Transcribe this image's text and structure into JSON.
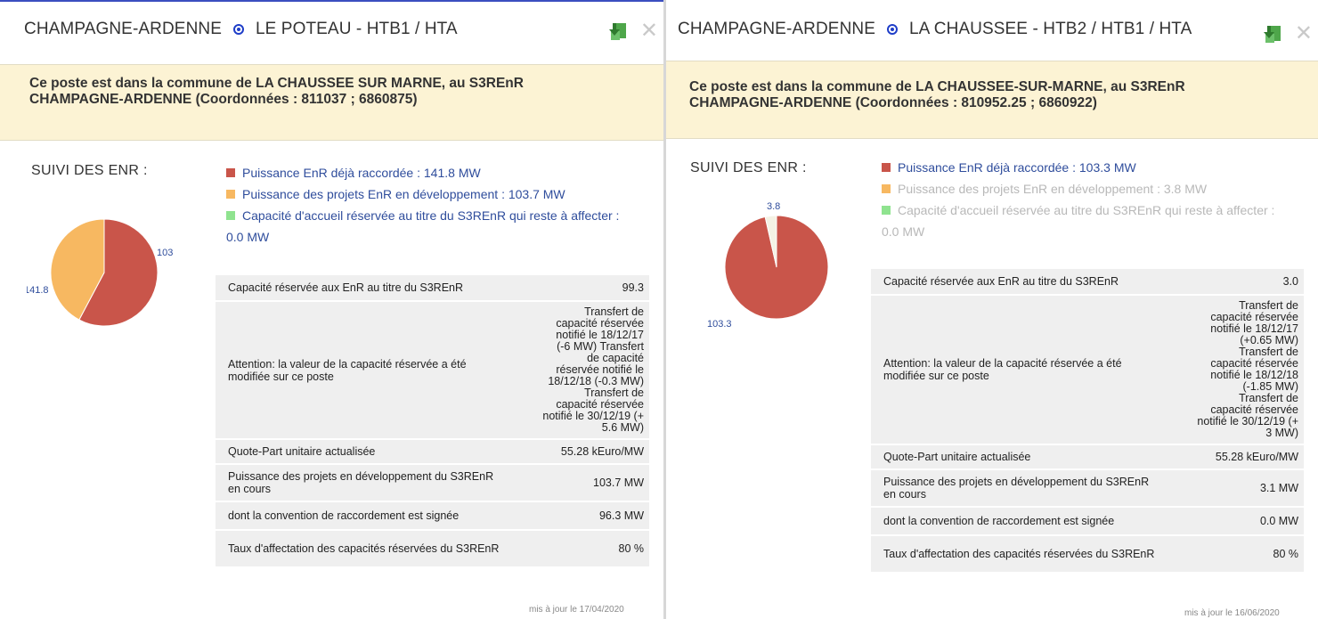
{
  "left": {
    "region": "CHAMPAGNE-ARDENNE",
    "post": "LE POTEAU - HTB1 / HTA",
    "banner_line1": "Ce poste est dans la commune de LA CHAUSSEE SUR MARNE, au S3REnR",
    "banner_line2": "CHAMPAGNE-ARDENNE (Coordonnées : 811037 ; 6860875)",
    "suivi": "SUIVI DES ENR :",
    "legend": [
      {
        "text": "Puissance EnR déjà raccordée : 141.8 MW",
        "color": "#c9554a"
      },
      {
        "text": "Puissance des projets EnR en développement : 103.7 MW",
        "color": "#f7b861"
      },
      {
        "text": "Capacité d'accueil réservée au titre du S3REnR qui reste à affecter : 0.0 MW",
        "color": "#8fe38f"
      }
    ],
    "pie": {
      "values": [
        141.8,
        103.7,
        0.0
      ],
      "labels": [
        "141.8",
        "103",
        ""
      ],
      "colors": [
        "#c9554a",
        "#f7b861",
        "#8fe38f"
      ]
    },
    "rows": [
      {
        "label": "Capacité réservée aux EnR au titre du S3REnR",
        "value": "99.3"
      },
      {
        "label": "Attention: la valeur de la capacité réservée a été modifiée sur ce poste",
        "value": "Transfert de capacité réservée notifié le 18/12/17 (-6 MW) Transfert de capacité réservée notifié le 18/12/18 (-0.3 MW) Transfert de capacité réservée notifié le 30/12/19 (+ 5.6 MW)"
      },
      {
        "label": "Quote-Part unitaire actualisée",
        "value": "55.28 kEuro/MW"
      },
      {
        "label": "Puissance des projets en développement du S3REnR en cours",
        "value": "103.7 MW"
      },
      {
        "label": "dont la convention de raccordement est signée",
        "value": "96.3 MW"
      },
      {
        "label": "Taux d'affectation des capacités réservées du S3REnR",
        "value": "80 %"
      }
    ],
    "maj": "mis à jour le 17/04/2020"
  },
  "right": {
    "region": "CHAMPAGNE-ARDENNE",
    "post": "LA CHAUSSEE - HTB2 / HTB1 / HTA",
    "banner_line1": "Ce poste est dans la commune de LA CHAUSSEE-SUR-MARNE, au S3REnR",
    "banner_line2": "CHAMPAGNE-ARDENNE (Coordonnées : 810952.25 ; 6860922)",
    "suivi": "SUIVI DES ENR :",
    "legend": [
      {
        "text": "Puissance EnR déjà raccordée : 103.3 MW",
        "color": "#c9554a"
      },
      {
        "text": "Puissance des projets EnR en développement : 3.8 MW",
        "color": "#f7b861"
      },
      {
        "text": "Capacité d'accueil réservée au titre du S3REnR qui reste à affecter : 0.0 MW",
        "color": "#8fe38f"
      }
    ],
    "pie": {
      "values": [
        103.3,
        3.8,
        0.0
      ],
      "labels": [
        "103.3",
        "3.8",
        ""
      ],
      "colors": [
        "#c9554a",
        "#f4f2e4",
        "#8fe38f"
      ]
    },
    "rows": [
      {
        "label": "Capacité réservée aux EnR au titre du S3REnR",
        "value": "3.0"
      },
      {
        "label": "Attention: la valeur de la capacité réservée a été modifiée sur ce poste",
        "value": "Transfert de capacité réservée notifié le 18/12/17 (+0.65 MW) Transfert de capacité réservée notifié le 18/12/18 (-1.85 MW) Transfert de capacité réservée notifié le 30/12/19 (+ 3 MW)"
      },
      {
        "label": "Quote-Part unitaire actualisée",
        "value": "55.28 kEuro/MW"
      },
      {
        "label": "Puissance des projets en développement du S3REnR en cours",
        "value": "3.1 MW"
      },
      {
        "label": "dont la convention de raccordement est signée",
        "value": "0.0 MW"
      },
      {
        "label": "Taux d'affectation des capacités réservées du S3REnR",
        "value": "80 %"
      }
    ],
    "maj": "mis à jour le 16/06/2020"
  },
  "icons": {
    "download": "download-excel-icon",
    "close": "close-icon",
    "radio": "radio-selected-icon"
  }
}
